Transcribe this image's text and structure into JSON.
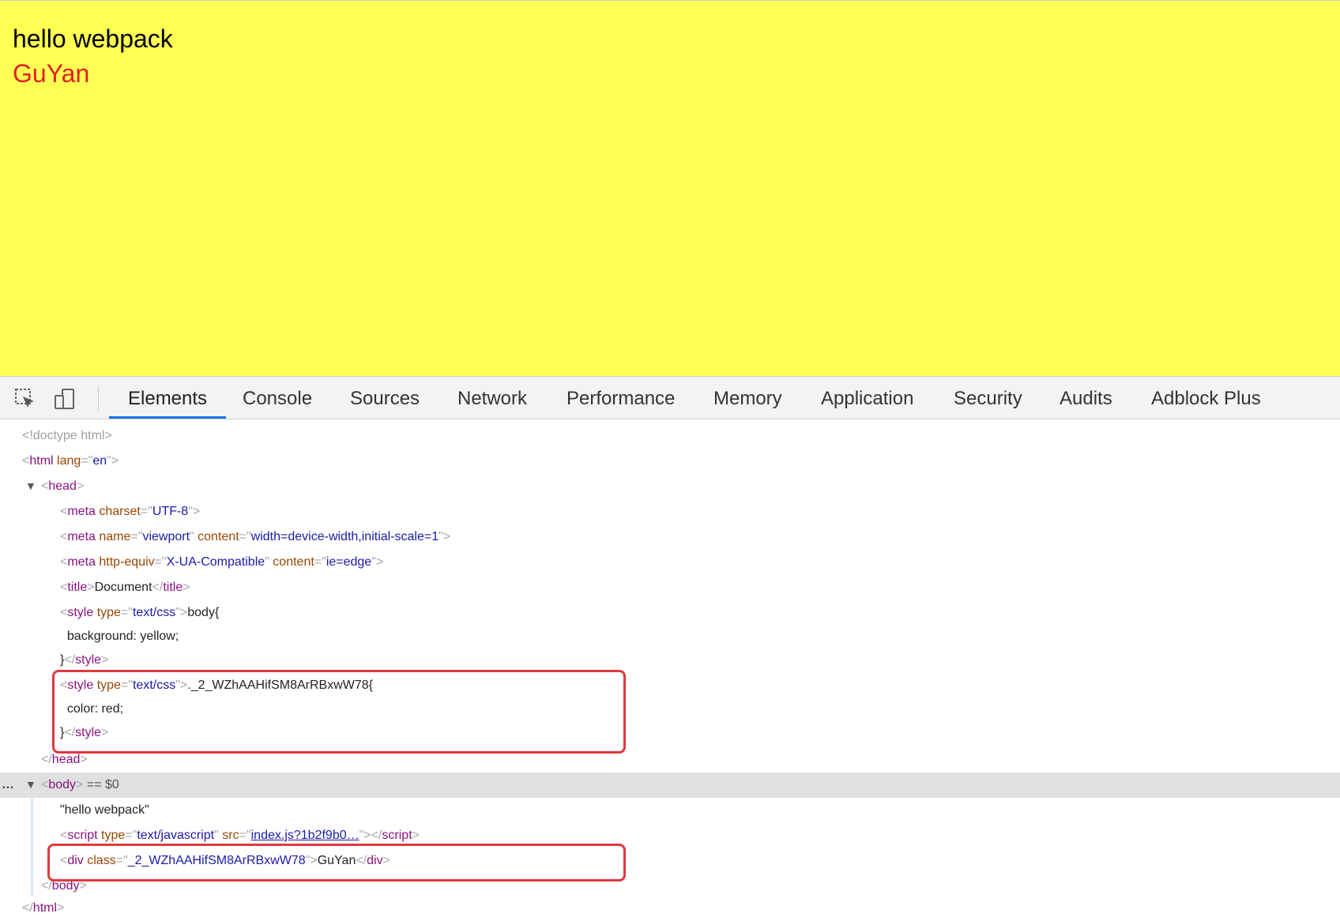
{
  "page": {
    "hello_text": "hello webpack",
    "guyan_text": "GuYan",
    "background_color": "#ffff54",
    "guyan_color": "#e0201e"
  },
  "devtools": {
    "icons": [
      "inspect-element-icon",
      "device-toolbar-icon"
    ],
    "tabs": [
      "Elements",
      "Console",
      "Sources",
      "Network",
      "Performance",
      "Memory",
      "Application",
      "Security",
      "Audits",
      "Adblock Plus"
    ],
    "active_tab": "Elements"
  },
  "dom": {
    "doctype": "<!doctype html>",
    "html_tag": "html",
    "html_lang_attr": "lang",
    "html_lang_val": "en",
    "head_tag": "head",
    "meta1_attr": "charset",
    "meta1_val": "UTF-8",
    "meta2_name_attr": "name",
    "meta2_name_val": "viewport",
    "meta2_content_attr": "content",
    "meta2_content_val": "width=device-width,initial-scale=1",
    "meta3_attr": "http-equiv",
    "meta3_val": "X-UA-Compatible",
    "meta3_content_attr": "content",
    "meta3_content_val": "ie=edge",
    "title_text": "Document",
    "style1_type_val": "text/css",
    "style1_line1": "body{",
    "style1_line2": "  background: yellow;",
    "style1_line3": "}",
    "style2_type_val": "text/css",
    "style2_line1": "._2_WZhAAHifSM8ArRBxwW78{",
    "style2_line2": "  color: red;",
    "style2_line3": "}",
    "body_marker": "== $0",
    "body_text": "\"hello webpack\"",
    "script_type_val": "text/javascript",
    "script_src_val": "index.js?1b2f9b0…",
    "div_class_val": "_2_WZhAAHifSM8ArRBxwW78",
    "div_text": "GuYan",
    "ellipsis": "…"
  },
  "highlight_color": "#e0393e"
}
